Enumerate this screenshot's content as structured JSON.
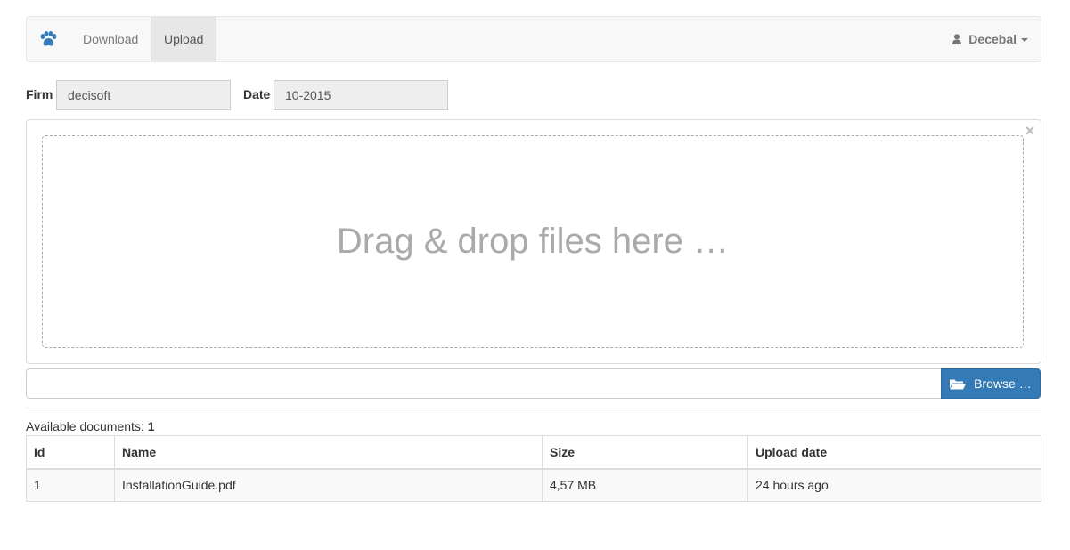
{
  "navbar": {
    "brand_icon": "paw-icon",
    "brand_color": "#337ab7",
    "items": [
      {
        "label": "Download",
        "active": false
      },
      {
        "label": "Upload",
        "active": true
      }
    ],
    "user": {
      "name": "Decebal",
      "icon": "user-icon"
    }
  },
  "form": {
    "firm_label": "Firm",
    "firm_value": "decisoft",
    "date_label": "Date",
    "date_value": "10-2015"
  },
  "dropzone": {
    "text": "Drag & drop files here …",
    "close_glyph": "×"
  },
  "browse": {
    "label": "Browse …",
    "icon": "folder-open-icon",
    "color": "#337ab7"
  },
  "documents": {
    "available_label": "Available documents:",
    "count": "1",
    "columns": [
      "Id",
      "Name",
      "Size",
      "Upload date"
    ],
    "rows": [
      {
        "id": "1",
        "name": "InstallationGuide.pdf",
        "size": "4,57 MB",
        "upload_date": "24 hours ago"
      }
    ]
  }
}
